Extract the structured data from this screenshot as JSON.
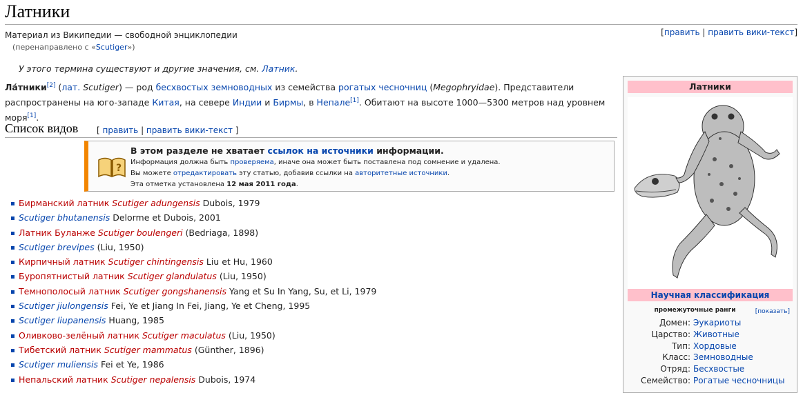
{
  "title": "Латники",
  "tagline": "Материал из Википедии — свободной энциклопедии",
  "redirect": {
    "prefix": "(перенаправлено с «",
    "link": "Scutiger",
    "suffix": "»)"
  },
  "top_edit": {
    "open": "[",
    "edit": "править",
    "sep": " | ",
    "edit_wiki": "править вики-текст",
    "close": "]"
  },
  "hatnote": {
    "text": "У этого термина существуют и другие значения, см. ",
    "link": "Латник",
    "end": "."
  },
  "lead": {
    "bold": "Ла́тники",
    "ref2": "[2]",
    "p1": " (",
    "lat_link": "лат.",
    "lat_name": " Scutiger",
    "p2": ") — род ",
    "link1": "бесхвостых земноводных",
    "p3": " из семейства ",
    "link2": "рогатых чесночниц",
    "p4": " (",
    "family_lat": "Megophryidae",
    "p5": "). Представители распространены на юго-западе ",
    "link3": "Китая",
    "p6": ", на севере ",
    "link4": "Индии",
    "p7": " и ",
    "link5": "Бирмы",
    "p8": ", в ",
    "link6": "Непале",
    "ref1a": "[1]",
    "p9": ". Обитают на высоте 1000—5300 метров над уровнем моря",
    "ref1b": "[1]",
    "p10": "."
  },
  "section": {
    "heading": "Список видов",
    "open": "[ ",
    "edit": "править",
    "sep": " | ",
    "edit_wiki": "править вики-текст",
    "close": " ]"
  },
  "ambox": {
    "title_a": "В этом разделе не хватает ",
    "title_link": "ссылок на источники",
    "title_b": " информации.",
    "l1a": "Информация должна быть ",
    "l1link": "проверяема",
    "l1b": ", иначе она может быть поставлена под сомнение и удалена.",
    "l2a": "Вы можете ",
    "l2link1": "отредактировать",
    "l2b": " эту статью, добавив ссылки на ",
    "l2link2": "авторитетные источники",
    "l2c": ".",
    "l3a": "Эта отметка установлена ",
    "l3date": "12 мая 2011 года",
    "l3b": "."
  },
  "species": [
    {
      "common": "Бирманский латник ",
      "latin": "Scutiger adungensis",
      "author": " Dubois, 1979"
    },
    {
      "common": "",
      "latin": "Scutiger bhutanensis",
      "author": " Delorme et Dubois, 2001"
    },
    {
      "common": "Латник Буланже ",
      "latin": "Scutiger boulengeri",
      "author": " (Bedriaga, 1898)"
    },
    {
      "common": "",
      "latin": "Scutiger brevipes",
      "author": " (Liu, 1950)"
    },
    {
      "common": "Кирпичный латник ",
      "latin": "Scutiger chintingensis",
      "author": " Liu et Hu, 1960"
    },
    {
      "common": "Буропятнистый латник ",
      "latin": "Scutiger glandulatus",
      "author": " (Liu, 1950)"
    },
    {
      "common": "Темнополосый латник ",
      "latin": "Scutiger gongshanensis",
      "author": " Yang et Su In Yang, Su, et Li, 1979"
    },
    {
      "common": "",
      "latin": "Scutiger jiulongensis",
      "author": " Fei, Ye et Jiang In Fei, Jiang, Ye et Cheng, 1995"
    },
    {
      "common": "",
      "latin": "Scutiger liupanensis",
      "author": " Huang, 1985"
    },
    {
      "common": "Оливково-зелёный латник ",
      "latin": "Scutiger maculatus",
      "author": " (Liu, 1950)"
    },
    {
      "common": "Тибетский латник ",
      "latin": "Scutiger mammatus",
      "author": " (Günther, 1896)"
    },
    {
      "common": "",
      "latin": "Scutiger muliensis",
      "author": " Fei et Ye, 1986"
    },
    {
      "common": "Непальский латник ",
      "latin": "Scutiger nepalensis",
      "author": " Dubois, 1974"
    }
  ],
  "infobox": {
    "title": "Латники",
    "classification": "Научная классификация",
    "ranks_label": "промежуточные ранги",
    "ranks_show": "[показать]",
    "rows": [
      {
        "rank": "Домен:",
        "value": "Эукариоты"
      },
      {
        "rank": "Царство:",
        "value": "Животные"
      },
      {
        "rank": "Тип:",
        "value": "Хордовые"
      },
      {
        "rank": "Класс:",
        "value": "Земноводные"
      },
      {
        "rank": "Отряд:",
        "value": "Бесхвостые"
      },
      {
        "rank": "Семейство:",
        "value": "Рогатые чесночницы"
      }
    ]
  },
  "colors": {
    "link": "#0645ad",
    "redlink": "#ba0000",
    "ambox_border": "#f28500",
    "infobox_header": "#ffc0cb"
  }
}
